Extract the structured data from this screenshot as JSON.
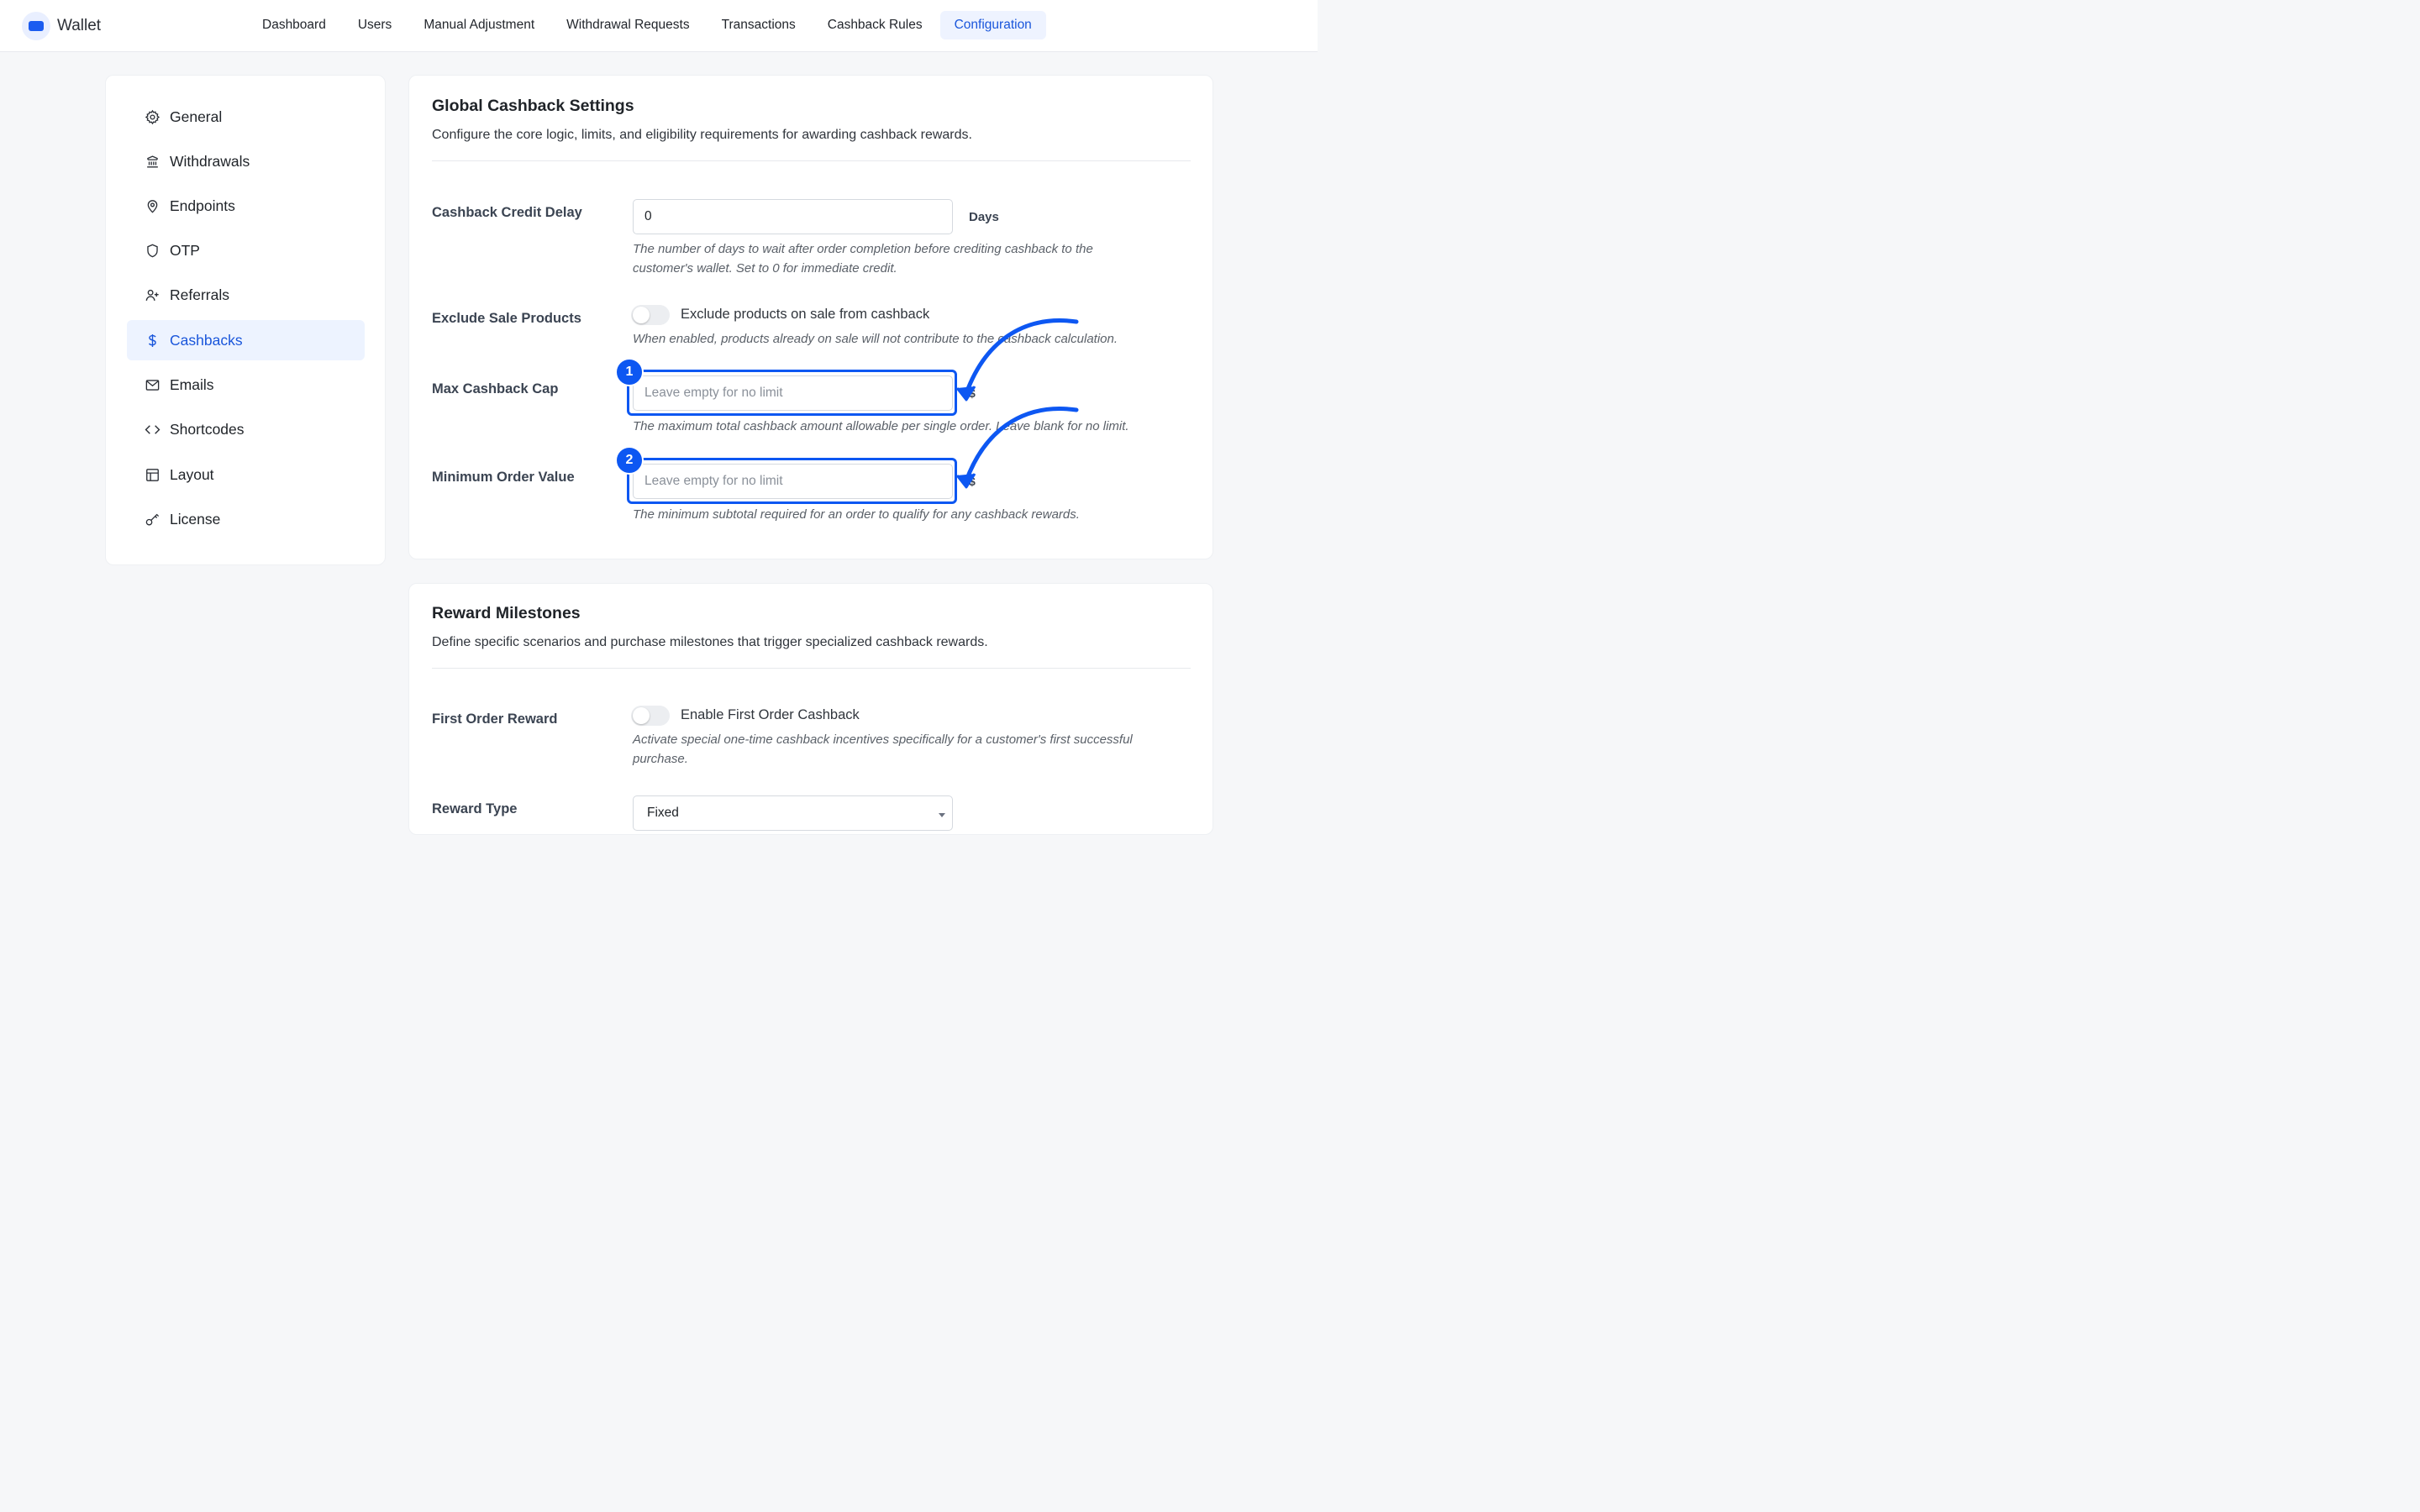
{
  "app": {
    "name": "Wallet"
  },
  "nav": {
    "items": [
      {
        "label": "Dashboard"
      },
      {
        "label": "Users"
      },
      {
        "label": "Manual Adjustment"
      },
      {
        "label": "Withdrawal Requests"
      },
      {
        "label": "Transactions"
      },
      {
        "label": "Cashback Rules"
      },
      {
        "label": "Configuration"
      }
    ],
    "active": "Configuration"
  },
  "sidebar": {
    "items": [
      {
        "label": "General",
        "icon": "gear-icon"
      },
      {
        "label": "Withdrawals",
        "icon": "bank-icon"
      },
      {
        "label": "Endpoints",
        "icon": "map-pin-icon"
      },
      {
        "label": "OTP",
        "icon": "shield-icon"
      },
      {
        "label": "Referrals",
        "icon": "user-plus-icon"
      },
      {
        "label": "Cashbacks",
        "icon": "dollar-icon"
      },
      {
        "label": "Emails",
        "icon": "mail-icon"
      },
      {
        "label": "Shortcodes",
        "icon": "code-icon"
      },
      {
        "label": "Layout",
        "icon": "layout-icon"
      },
      {
        "label": "License",
        "icon": "key-icon"
      }
    ],
    "active": "Cashbacks"
  },
  "global": {
    "title": "Global Cashback Settings",
    "description": "Configure the core logic, limits, and eligibility requirements for awarding cashback rewards.",
    "credit_delay": {
      "label": "Cashback Credit Delay",
      "value": "0",
      "suffix": "Days",
      "help_line1": "The number of days to wait after order completion before crediting cashback to the",
      "help_line2": "customer's wallet. Set to 0 for immediate credit."
    },
    "exclude_sale": {
      "label": "Exclude Sale Products",
      "toggle_label": "Exclude products on sale from cashback",
      "enabled": false,
      "help": "When enabled, products already on sale will not contribute to the cashback calculation."
    },
    "max_cap": {
      "label": "Max Cashback Cap",
      "placeholder": "Leave empty for no limit",
      "suffix": "$",
      "help": "The maximum total cashback amount allowable per single order. Leave blank for no limit.",
      "badge": "1"
    },
    "min_order": {
      "label": "Minimum Order Value",
      "placeholder": "Leave empty for no limit",
      "suffix": "$",
      "help": "The minimum subtotal required for an order to qualify for any cashback rewards.",
      "badge": "2"
    }
  },
  "milestones": {
    "title": "Reward Milestones",
    "description": "Define specific scenarios and purchase milestones that trigger specialized cashback rewards.",
    "first_order": {
      "label": "First Order Reward",
      "toggle_label": "Enable First Order Cashback",
      "enabled": false,
      "help_line1": "Activate special one-time cashback incentives specifically for a customer's first successful",
      "help_line2": "purchase."
    },
    "reward_type": {
      "label": "Reward Type",
      "value": "Fixed"
    }
  },
  "colors": {
    "accent": "#1a56db",
    "highlight": "#0d57f2",
    "active_bg": "#edf3ff"
  }
}
